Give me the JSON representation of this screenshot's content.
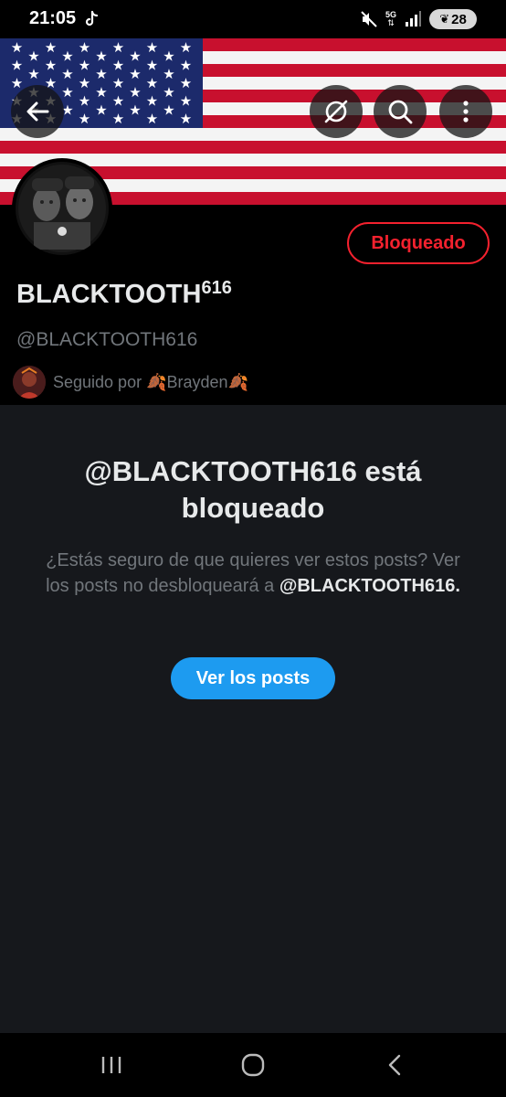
{
  "status_bar": {
    "time": "21:05",
    "network_label": "5G",
    "battery": "28",
    "icons": [
      "tiktok-icon",
      "mute-icon",
      "signal-icon",
      "battery-icon"
    ]
  },
  "header": {
    "banner": "us-flag-banner",
    "buttons": [
      "back-arrow-icon",
      "grok-icon",
      "search-icon",
      "more-vertical-icon"
    ]
  },
  "profile": {
    "display_name": "BLACKTOOTH",
    "display_name_superscript": "616",
    "handle": "@BLACKTOOTH616",
    "blocked_button_label": "Bloqueado",
    "followed_by": "Seguido por 🍂Brayden🍂"
  },
  "blocked_notice": {
    "title": "@BLACKTOOTH616 está bloqueado",
    "body_text": "¿Estás seguro de que quieres ver estos posts? Ver los posts no desbloqueará a",
    "body_handle": "@BLACKTOOTH616.",
    "view_button_label": "Ver los posts"
  },
  "nav_bar": {
    "buttons": [
      "recents-icon",
      "home-icon",
      "back-icon"
    ]
  },
  "colors": {
    "background": "#16181c",
    "profile_background": "#000000",
    "blocked_red": "#f4212e",
    "accent_blue": "#1d9bf0",
    "secondary_text": "#71767b"
  }
}
